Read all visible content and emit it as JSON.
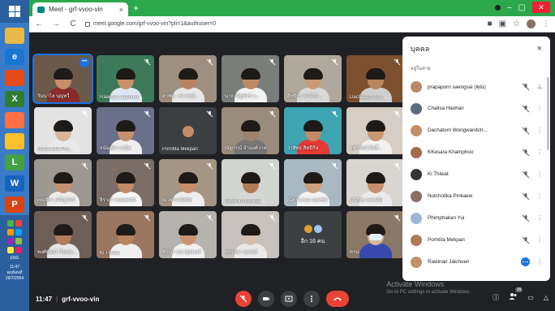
{
  "browser": {
    "tab_title": "Meet - grf-vvoo-vin",
    "tab_close": "×",
    "new_tab": "+",
    "url": "meet.google.com/grf-vvoo-vin?pli=1&authuser=0",
    "back": "←",
    "forward": "→",
    "reload": "C"
  },
  "taskbar": {
    "time": "11:47",
    "lang": "ENG",
    "date_line1": "พฤหัสบดี",
    "date_line2": "29/7/2564"
  },
  "tiles": [
    {
      "name": "วันนาไล บุญทวี",
      "face": "#c68e6a",
      "bg": "#6b5a4a",
      "body": "#8a2a2a",
      "active": true,
      "more": true
    },
    {
      "name": "Rawinan Jaichuen",
      "face": "#c9926c",
      "bg": "#3d7a5a",
      "body": "#dfe7f0"
    },
    {
      "name": "ลาพัด...ซอ พงษ์...",
      "face": "#b7825d",
      "bg": "#9e8f80",
      "body": "#e8e8e8"
    },
    {
      "name": "นาย ณัฐพัชร์ แ...",
      "face": "#c08a66",
      "bg": "#7a7e7a",
      "body": "#f2f2f2"
    },
    {
      "name": "อิทธิกร ดาวลับ...",
      "face": "#c99a74",
      "bg": "#b0a89c",
      "body": "#d9d9d9"
    },
    {
      "name": "Dachatorn Wo...",
      "face": "#b98660",
      "bg": "#7d5030",
      "body": "#cfcfcf"
    },
    {
      "name": "Nutchotika Pin...",
      "face": "#d8b49a",
      "bg": "#e3e3e3",
      "body": "#e9e9e9"
    },
    {
      "name": "ธนันต์ภา จงจิต",
      "face": "#c7916e",
      "bg": "#6a6f8a",
      "body": "#eeeeee"
    },
    {
      "name": "Porntita Mekpan",
      "face": "#c48d69",
      "bg": "#3c4043",
      "body": "#3c4043",
      "small": true
    },
    {
      "name": "ณัฐกรณ์ จำนงค์วาย",
      "face": "#a0836a",
      "bg": "#9a8c7c",
      "body": "#777"
    },
    {
      "name": "วาสิทธ สิทธิกิจ",
      "face": "#c28b63",
      "bg": "#3fa4b1",
      "body": "#e53935"
    },
    {
      "name": "จุฬารัตน์ สิทธิ์...",
      "face": "#c79874",
      "bg": "#d6cdc4",
      "body": "#f1f1f1"
    },
    {
      "name": "เขมจิรา เจริญรัตน์",
      "face": "#c7916e",
      "bg": "#9d9892",
      "body": "#ececec"
    },
    {
      "name": "จิราภา พลอยหลัก",
      "face": "#c28a68",
      "bg": "#7a6e66",
      "body": "#f5f5f5"
    },
    {
      "name": "ณวส ชาติสนิท",
      "face": "#c68e6a",
      "bg": "#a49585",
      "body": "#eeeeee"
    },
    {
      "name": "Sasikorn Laokaa",
      "face": "#b07b58",
      "bg": "#d0d5cf",
      "body": "#d7d7d7"
    },
    {
      "name": "ณิตาวรรณ นนทชัย",
      "face": "#caa07e",
      "bg": "#aab8c2",
      "body": "#f2f2f2"
    },
    {
      "name": "นวิภัทร เพชรนิล",
      "face": "#c58f6d",
      "bg": "#d9d6d2",
      "body": "#eaeaea"
    },
    {
      "name": "พงศ์พัฒน์ เรียนพ...",
      "face": "#b27d5a",
      "bg": "#6d5f57",
      "body": "#e6e6e6"
    },
    {
      "name": "Ki Thiwat",
      "face": "#b78560",
      "bg": "#9b7660",
      "body": "#efefef"
    },
    {
      "name": "ชิรญา ธนาสุขมนต์",
      "face": "#c9946f",
      "bg": "#b6b2ae",
      "body": "#f0f0f0"
    },
    {
      "name": "สุพรรษา ทุกพงศ์",
      "face": "#d3bfae",
      "bg": "#c7c2bd",
      "body": "#e9e9e9"
    },
    {
      "name": "Others",
      "others": true,
      "label": "อีก 16 คน"
    },
    {
      "name": "ครม",
      "face": "#d7b79a",
      "bg": "#8a7966",
      "body": "#3949ab",
      "mask": true
    }
  ],
  "panel": {
    "title": "บุคคล",
    "close": "×",
    "section": "อยู่ในสาย",
    "people": [
      {
        "name": "prapaporn saengsai (คุณ)",
        "av": "#b98a6a",
        "action": "pin"
      },
      {
        "name": "Chalisa Haohan",
        "av": "#5d6b7d",
        "action": "more"
      },
      {
        "name": "Dachatorn Wongwanitch...",
        "av": "#c48e6c",
        "action": "more"
      },
      {
        "name": "KKesara Khamphoo",
        "av": "#a36b4e",
        "action": "more"
      },
      {
        "name": "Ki Thiwat",
        "av": "#343434",
        "action": "more"
      },
      {
        "name": "Nutchotika Pinkaew",
        "av": "#8d6e63",
        "action": "more"
      },
      {
        "name": "Phimphakan Yui",
        "av": "#9db7d4",
        "action": "more"
      },
      {
        "name": "Porntita Mekpan",
        "av": "#b07a58",
        "action": "more"
      },
      {
        "name": "Rawinan Jaichuen",
        "av": "#c2906e",
        "action": "more",
        "speaking": true
      }
    ]
  },
  "bottom": {
    "time": "11:47",
    "separator": "|",
    "meeting_code": "grf-vvoo-vin",
    "participants_count": "39"
  },
  "watermark": {
    "line1": "Activate Windows",
    "line2": "Go to PC settings to activate Windows."
  },
  "colors": {
    "tab_strip": "#2aa84a",
    "meet_bg": "#202124",
    "tile_bg": "#3c4043",
    "accent": "#1a73e8",
    "end_call": "#ea4335"
  }
}
